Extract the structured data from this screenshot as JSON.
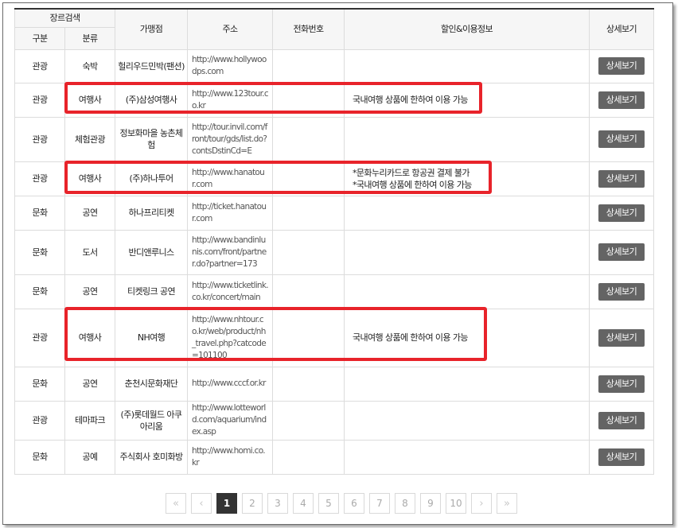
{
  "table": {
    "header": {
      "genre_search": "장르검색",
      "category": "구분",
      "type": "분류",
      "merchant": "가맹점",
      "address": "주소",
      "phone": "전화번호",
      "discount_info": "할인&이용정보",
      "details": "상세보기"
    },
    "detail_button_label": "상세보기",
    "rows": [
      {
        "category": "관광",
        "type": "숙박",
        "merchant": "헐리우드민박(팬션)",
        "url": "http://www.hollywoodps.com",
        "phone": "",
        "info": []
      },
      {
        "category": "관광",
        "type": "여행사",
        "merchant": "(주)삼성여행사",
        "url": "http://www.123tour.co.kr",
        "phone": "",
        "info": [
          "국내여행 상품에 한하여 이용 가능"
        ]
      },
      {
        "category": "관광",
        "type": "체험관광",
        "merchant": "정보화마을 농촌체험",
        "url": "http://tour.invil.com/front/tour/gds/list.do?contsDstinCd=E",
        "phone": "",
        "info": []
      },
      {
        "category": "관광",
        "type": "여행사",
        "merchant": "(주)하나투어",
        "url": "http://www.hanatour.com",
        "phone": "",
        "info": [
          "*문화누리카드로 항공권 결제 불가",
          "*국내여행 상품에 한하여 이용 가능"
        ]
      },
      {
        "category": "문화",
        "type": "공연",
        "merchant": "하나프리티켓",
        "url": "http://ticket.hanatour.com",
        "phone": "",
        "info": []
      },
      {
        "category": "문화",
        "type": "도서",
        "merchant": "반디앤루니스",
        "url": "http://www.bandinlunis.com/front/partner.do?partner=173",
        "phone": "",
        "info": []
      },
      {
        "category": "문화",
        "type": "공연",
        "merchant": "티켓링크 공연",
        "url": "http://www.ticketlink.co.kr/concert/main",
        "phone": "",
        "info": []
      },
      {
        "category": "관광",
        "type": "여행사",
        "merchant": "NH여행",
        "url": "http://www.nhtour.co.kr/web/product/nh_travel.php?catcode=101100",
        "phone": "",
        "info": [
          "국내여행 상품에 한하여 이용 가능"
        ]
      },
      {
        "category": "문화",
        "type": "공연",
        "merchant": "춘천시문화재단",
        "url": "http://www.cccf.or.kr",
        "phone": "",
        "info": []
      },
      {
        "category": "관광",
        "type": "테마파크",
        "merchant": "(주)롯데월드 아쿠아리움",
        "url": "http://www.lotteworld.com/aquarium/index.asp",
        "phone": "",
        "info": []
      },
      {
        "category": "문화",
        "type": "공예",
        "merchant": "주식회사 호미화방",
        "url": "http://www.homi.co.kr",
        "phone": "",
        "info": []
      }
    ]
  },
  "pagination": {
    "first": "«",
    "prev": "‹",
    "pages": [
      "1",
      "2",
      "3",
      "4",
      "5",
      "6",
      "7",
      "8",
      "9",
      "10"
    ],
    "current": "1",
    "next": "›",
    "last": "»"
  },
  "colors": {
    "highlight": "#e8232a",
    "button_bg": "#646464",
    "header_bg": "#f6f6f6",
    "active_page_bg": "#333333"
  }
}
